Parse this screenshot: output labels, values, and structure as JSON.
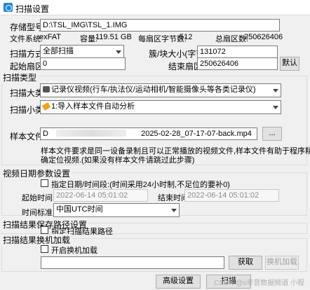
{
  "window": {
    "title": "扫描设置"
  },
  "storage": {
    "path_label": "存储型号:",
    "path_value": "D:\\TSL_IMG\\TSL_1.IMG",
    "fs_label": "文件系统:",
    "fs_value": "exFAT",
    "capacity_label": "容量:",
    "capacity_value": "119.51 GB",
    "sector_bytes_label": "每扇区字节数:",
    "sector_bytes_value": "512",
    "total_sectors_label": "总扇区数:",
    "total_sectors_value": "250626406"
  },
  "scan": {
    "mode_label": "扫描方式:",
    "mode_value": "全部扫描",
    "block_size_label": "簇/块大小(字节):",
    "block_size_value": "131072",
    "start_label": "起始扇区:",
    "start_value": "0",
    "end_label": "结束扇区:",
    "end_value": "250626406",
    "default_button": "默认"
  },
  "scan_type": {
    "group_label": "扫描类型",
    "category_label": "扫描大类:",
    "category_value": "记录仪视频(行车/执法仪/运动相机/智能摄像头等各类记录仪)",
    "subcategory_label": "扫描小类:",
    "subcategory_value": "1:导入样本文件自动分析",
    "sample_label": "样本文件:",
    "sample_value_prefix": "D",
    "sample_value_suffix": "2025-02-28_07-17-07-back.mp4",
    "browse_button": "...",
    "note_line1": "样本文件要求是同一设备录制且可以正常播放的视频文件,样本文件有助于程序精",
    "note_line2": "确定位视频.(如果没有样本文件请跳过此步骤)"
  },
  "video_date": {
    "group_label": "视频日期参数设置",
    "specify_label": "指定日期/时间段:(时间采用24小时制,不足位的要补0)",
    "start_label": "起始时间:",
    "start_value": "2022-06-14 05:01:02",
    "end_label": "结束时间:",
    "end_value": "2022-06-14 05:01:02",
    "tz_label": "时间标准:",
    "tz_value": "中国UTC时间"
  },
  "save_path": {
    "group_label": "扫描结果保存路径设置",
    "specify_label": "指定扫描结果路径",
    "swap_group_label": "扫描结果换机加载",
    "swap_enable_label": "开启换机加载",
    "get_button": "获取",
    "swap_button": "换机加载"
  },
  "footer": {
    "advanced_button": "高级设置",
    "scan_button": "扫描",
    "watermark": "CSDN @s孝音数据频道 小程"
  }
}
